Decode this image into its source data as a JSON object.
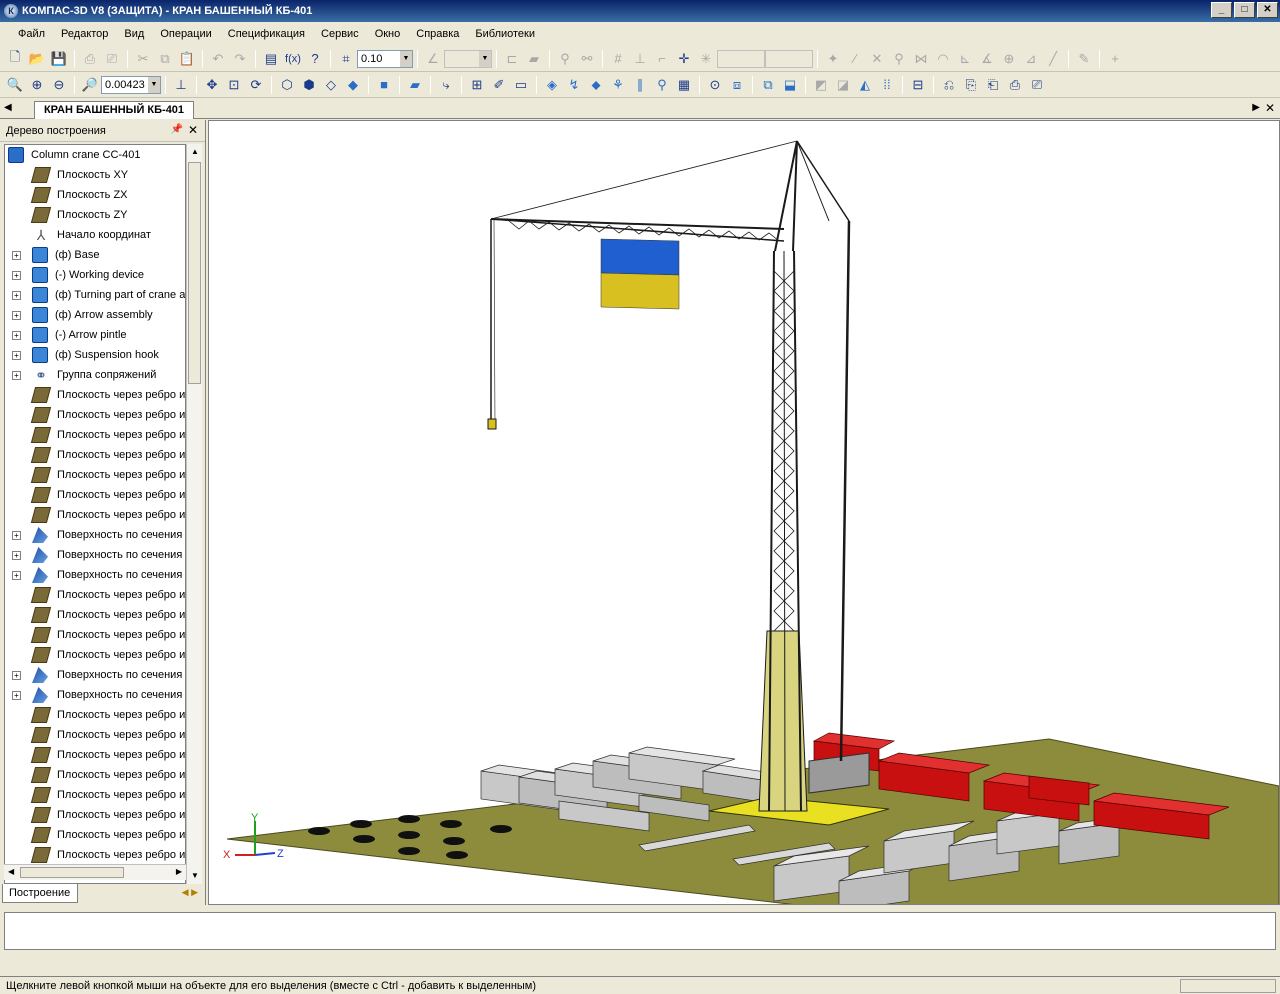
{
  "window": {
    "title": "КОМПАС-3D V8 (ЗАЩИТА) - КРАН БАШЕННЫЙ КБ-401",
    "minimize": "_",
    "maximize": "□",
    "close": "✕"
  },
  "menu": [
    "Файл",
    "Редактор",
    "Вид",
    "Операции",
    "Спецификация",
    "Сервис",
    "Окно",
    "Справка",
    "Библиотеки"
  ],
  "toolbar1": {
    "step_value": "0.10"
  },
  "toolbar2": {
    "zoom_value": "0.00423"
  },
  "document_tab": {
    "label": "КРАН БАШЕННЫЙ КБ-401"
  },
  "tree_panel": {
    "title": "Дерево построения",
    "bottom_tab": "Построение",
    "items": [
      {
        "label": "Column crane CC-401",
        "icon": "assembly-icon",
        "expand": ""
      },
      {
        "label": "Плоскость XY",
        "icon": "plane-icon",
        "expand": ""
      },
      {
        "label": "Плоскость ZX",
        "icon": "plane-icon",
        "expand": ""
      },
      {
        "label": "Плоскость ZY",
        "icon": "plane-icon",
        "expand": ""
      },
      {
        "label": "Начало координат",
        "icon": "origin-icon",
        "expand": ""
      },
      {
        "label": "(ф) Base",
        "icon": "part-icon",
        "expand": "+"
      },
      {
        "label": "(-) Working device",
        "icon": "part-icon",
        "expand": "+"
      },
      {
        "label": "(ф) Turning part of crane a",
        "icon": "part-icon",
        "expand": "+"
      },
      {
        "label": "(ф)  Arrow assembly",
        "icon": "part-icon",
        "expand": "+"
      },
      {
        "label": "(-) Arrow pintle",
        "icon": "part-icon",
        "expand": "+"
      },
      {
        "label": "(ф) Suspension hook",
        "icon": "part-icon",
        "expand": "+"
      },
      {
        "label": "Группа сопряжений",
        "icon": "mate-icon",
        "expand": "+"
      },
      {
        "label": "Плоскость через ребро и",
        "icon": "plane-icon",
        "expand": ""
      },
      {
        "label": "Плоскость через ребро и",
        "icon": "plane-icon",
        "expand": ""
      },
      {
        "label": "Плоскость через ребро и",
        "icon": "plane-icon",
        "expand": ""
      },
      {
        "label": "Плоскость через ребро и",
        "icon": "plane-icon",
        "expand": ""
      },
      {
        "label": "Плоскость через ребро и",
        "icon": "plane-icon",
        "expand": ""
      },
      {
        "label": "Плоскость через ребро и",
        "icon": "plane-icon",
        "expand": ""
      },
      {
        "label": "Плоскость через ребро и",
        "icon": "plane-icon",
        "expand": ""
      },
      {
        "label": "Поверхность по сечения",
        "icon": "surface-icon",
        "expand": "+"
      },
      {
        "label": "Поверхность по сечения",
        "icon": "surface-icon",
        "expand": "+"
      },
      {
        "label": "Поверхность по сечения",
        "icon": "surface-icon",
        "expand": "+"
      },
      {
        "label": "Плоскость через ребро и",
        "icon": "plane-icon",
        "expand": ""
      },
      {
        "label": "Плоскость через ребро и",
        "icon": "plane-icon",
        "expand": ""
      },
      {
        "label": "Плоскость через ребро и",
        "icon": "plane-icon",
        "expand": ""
      },
      {
        "label": "Плоскость через ребро и",
        "icon": "plane-icon",
        "expand": ""
      },
      {
        "label": "Поверхность по сечения",
        "icon": "surface-icon",
        "expand": "+"
      },
      {
        "label": "Поверхность по сечения",
        "icon": "surface-icon",
        "expand": "+"
      },
      {
        "label": "Плоскость через ребро и",
        "icon": "plane-icon",
        "expand": ""
      },
      {
        "label": "Плоскость через ребро и",
        "icon": "plane-icon",
        "expand": ""
      },
      {
        "label": "Плоскость через ребро и",
        "icon": "plane-icon",
        "expand": ""
      },
      {
        "label": "Плоскость через ребро и",
        "icon": "plane-icon",
        "expand": ""
      },
      {
        "label": "Плоскость через ребро и",
        "icon": "plane-icon",
        "expand": ""
      },
      {
        "label": "Плоскость через ребро и",
        "icon": "plane-icon",
        "expand": ""
      },
      {
        "label": "Плоскость через ребро и",
        "icon": "plane-icon",
        "expand": ""
      },
      {
        "label": "Плоскость через ребро и",
        "icon": "plane-icon",
        "expand": ""
      }
    ]
  },
  "viewport": {
    "axis_labels": {
      "x": "X",
      "y": "Y",
      "z": "Z"
    },
    "flag_colors": {
      "top": "#1f5fd0",
      "bottom": "#d8c020"
    },
    "ground_color": "#8a8a3c",
    "crane_color": "#e8e020",
    "pipe_color": "#c81010"
  },
  "status": {
    "message": "Щелкните левой кнопкой мыши на объекте для его выделения (вместе с Ctrl - добавить к выделенным)"
  }
}
